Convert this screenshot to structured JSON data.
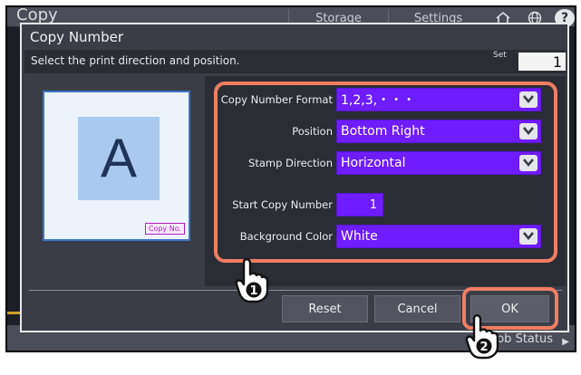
{
  "app": {
    "title": "Copy",
    "tabs": [
      "Storage",
      "Settings"
    ],
    "job_status": "Job Status"
  },
  "dialog": {
    "title": "Copy Number",
    "message": "Select the print direction and position.",
    "set_label": "Set",
    "set_value": "1"
  },
  "preview": {
    "letter": "A",
    "stamp": "Copy No."
  },
  "fields": {
    "format_label": "Copy Number Format",
    "format_value": "1,2,3,・・・",
    "position_label": "Position",
    "position_value": "Bottom Right",
    "direction_label": "Stamp Direction",
    "direction_value": "Horizontal",
    "start_label": "Start Copy Number",
    "start_value": "1",
    "bg_label": "Background Color",
    "bg_value": "White"
  },
  "buttons": {
    "reset": "Reset",
    "cancel": "Cancel",
    "ok": "OK"
  },
  "annotations": {
    "step1": "1",
    "step2": "2",
    "highlight_color": "#ef7e63"
  },
  "colors": {
    "select_bg": "#6f1cff",
    "stamp_color": "#b41ec8",
    "preview_border": "#3b74c7"
  }
}
